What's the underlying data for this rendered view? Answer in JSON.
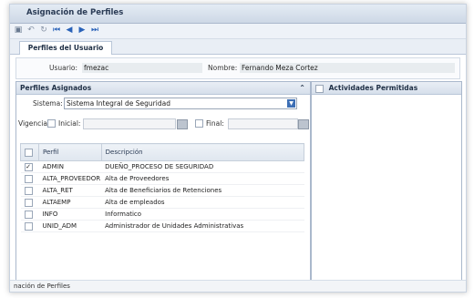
{
  "window": {
    "title": "Asignación de Perfiles"
  },
  "toolbar": {
    "icons": [
      "save-icon",
      "undo-icon",
      "refresh-icon",
      "first-icon",
      "prev-icon",
      "next-icon",
      "last-icon"
    ]
  },
  "tabs": [
    {
      "label": "Perfiles del Usuario"
    }
  ],
  "user": {
    "usuario_label": "Usuario:",
    "usuario_value": "fmezac",
    "nombre_label": "Nombre:",
    "nombre_value": "Fernando Meza Cortez"
  },
  "profiles_panel": {
    "title": "Perfiles Asignados",
    "sistema_label": "Sistema:",
    "sistema_value": "Sistema Integral de Seguridad",
    "vigencia_label": "Vigencia:",
    "inicial_label": "Inicial:",
    "final_label": "Final:",
    "columns": [
      "Perfil",
      "Descripción"
    ],
    "rows": [
      {
        "checked": true,
        "perfil": "ADMIN",
        "descripcion": "DUEÑO_PROCESO DE SEGURIDAD"
      },
      {
        "checked": false,
        "perfil": "ALTA_PROVEEDOR",
        "descripcion": "Alta de Proveedores"
      },
      {
        "checked": false,
        "perfil": "ALTA_RET",
        "descripcion": "Alta de Beneficiarios de Retenciones"
      },
      {
        "checked": false,
        "perfil": "ALTAEMP",
        "descripcion": "Alta de empleados"
      },
      {
        "checked": false,
        "perfil": "INFO",
        "descripcion": "Informatico"
      },
      {
        "checked": false,
        "perfil": "UNID_ADM",
        "descripcion": "Administrador de Unidades Administrativas"
      }
    ]
  },
  "activities_panel": {
    "title": "Actividades Permitidas"
  },
  "status": {
    "text": "nación de Perfiles"
  },
  "colors": {
    "accent": "#3d6fb5",
    "header_bg": "#dfe6ef"
  }
}
